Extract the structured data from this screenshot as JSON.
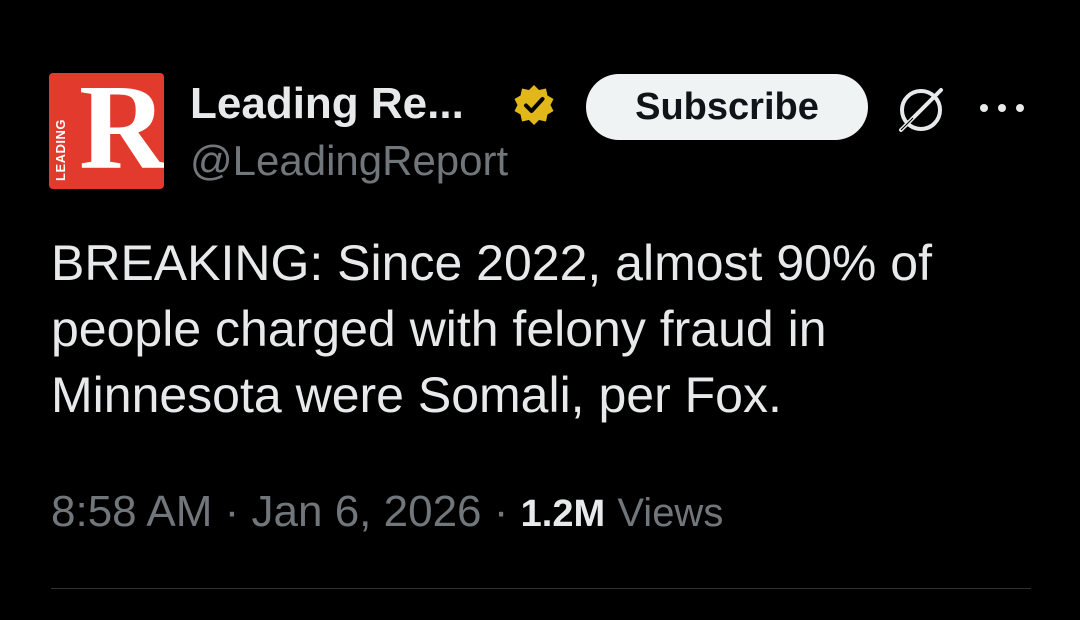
{
  "author": {
    "display_name": "Leading Re...",
    "handle": "@LeadingReport",
    "avatar_letter": "R",
    "avatar_vertical_text": "LEADING",
    "avatar_color": "#e23b2e",
    "verified_badge": "verified-gold-badge-icon"
  },
  "actions": {
    "subscribe_label": "Subscribe",
    "grok_icon": "grok-icon",
    "more_icon": "more-horizontal-icon"
  },
  "tweet": {
    "text": "BREAKING: Since 2022, almost 90% of people charged with felony fraud in Minnesota were Somali, per Fox."
  },
  "meta": {
    "time": "8:58 AM",
    "separator": " · ",
    "date": "Jan 6, 2026",
    "views_count": "1.2M",
    "views_label": "Views"
  },
  "colors": {
    "background": "#000000",
    "primary_text": "#e7e9ea",
    "secondary_text": "#71767b",
    "badge_gold": "#e2b719",
    "button_bg": "#eff3f4"
  }
}
